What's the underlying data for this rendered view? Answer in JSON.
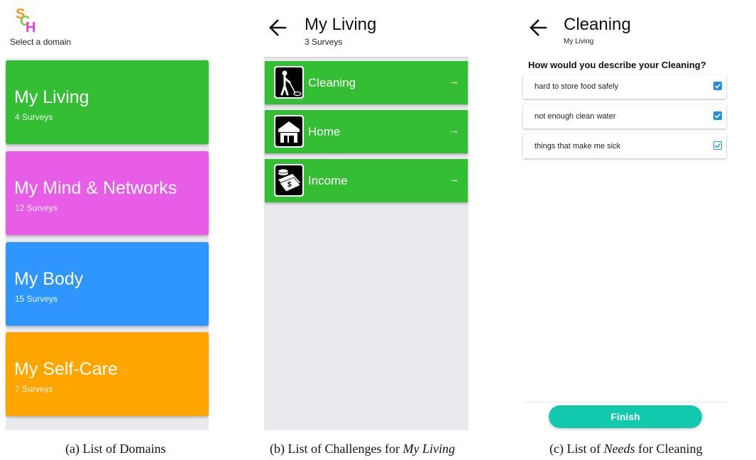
{
  "panel_a": {
    "subtitle": "Select a domain",
    "logo": {
      "text": "SCH",
      "colors": [
        "#f7941d",
        "#8dc63f",
        "#e83fe5"
      ]
    },
    "domains": [
      {
        "name": "My Living",
        "count": "4 Surveys",
        "color": "#34be34"
      },
      {
        "name": "My Mind & Networks",
        "count": "12 Surveys",
        "color": "#e85de8"
      },
      {
        "name": "My Body",
        "count": "15 Surveys",
        "color": "#2f95ff"
      },
      {
        "name": "My Self-Care",
        "count": "7 Surveys",
        "color": "#ffa500"
      }
    ]
  },
  "panel_b": {
    "title": "My Living",
    "subtitle": "3 Surveys",
    "back_icon": "arrow-left-icon",
    "challenges": [
      {
        "label": "Cleaning",
        "icon": "cleaning-icon",
        "arrow": "→"
      },
      {
        "label": "Home",
        "icon": "home-icon",
        "arrow": "→"
      },
      {
        "label": "Income",
        "icon": "income-icon",
        "arrow": "→"
      }
    ]
  },
  "panel_c": {
    "title": "Cleaning",
    "subtitle": "My Living",
    "back_icon": "arrow-left-icon",
    "question": "How would you describe your Cleaning?",
    "needs": [
      {
        "label": "hard to store food safely",
        "checked": true,
        "style": "filled"
      },
      {
        "label": "not enough clean water",
        "checked": true,
        "style": "filled"
      },
      {
        "label": "things that make me sick",
        "checked": true,
        "style": "outline"
      }
    ],
    "finish_label": "Finish",
    "accent": "#12c9ad",
    "checkbox_color": "#1e8ee6"
  },
  "captions": {
    "a": "(a) List of Domains",
    "b_prefix": "(b) List of Challenges for ",
    "b_italic": "My Living",
    "c_prefix": "(c) List of ",
    "c_italic": "Needs",
    "c_suffix": " for Cleaning"
  }
}
